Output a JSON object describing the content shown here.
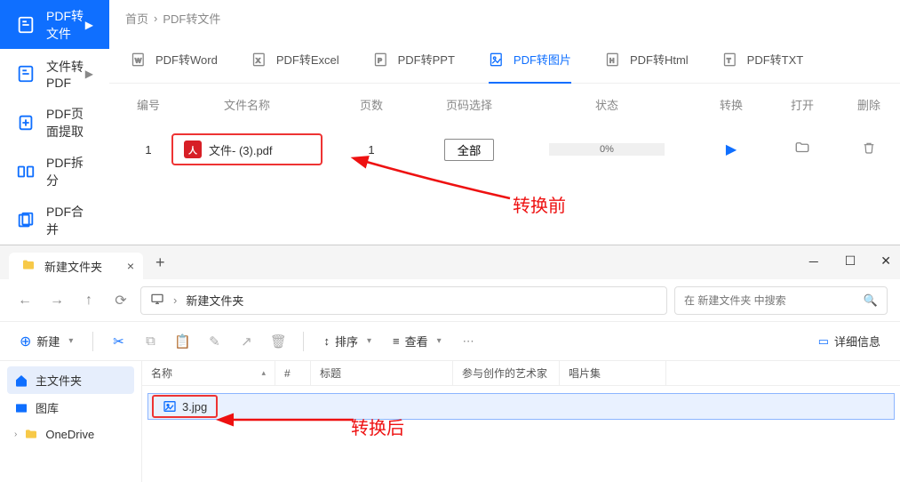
{
  "sidebar": {
    "items": [
      {
        "label": "PDF转文件",
        "arrow": "▶"
      },
      {
        "label": "文件转PDF",
        "arrow": "▶"
      },
      {
        "label": "PDF页面提取",
        "arrow": ""
      },
      {
        "label": "PDF拆分",
        "arrow": ""
      },
      {
        "label": "PDF合并",
        "arrow": ""
      }
    ]
  },
  "breadcrumb": {
    "home": "首页",
    "sep": "›",
    "current": "PDF转文件"
  },
  "tabs": [
    {
      "label": "PDF转Word"
    },
    {
      "label": "PDF转Excel"
    },
    {
      "label": "PDF转PPT"
    },
    {
      "label": "PDF转图片"
    },
    {
      "label": "PDF转Html"
    },
    {
      "label": "PDF转TXT"
    }
  ],
  "thead": {
    "num": "编号",
    "name": "文件名称",
    "pages": "页数",
    "select": "页码选择",
    "status": "状态",
    "conv": "转换",
    "open": "打开",
    "del": "删除"
  },
  "row": {
    "num": "1",
    "filename": "文件- (3).pdf",
    "pages": "1",
    "select_label": "全部",
    "progress": "0%"
  },
  "annotations": {
    "before": "转换前",
    "after": "转换后"
  },
  "explorer": {
    "tab_title": "新建文件夹",
    "path": "新建文件夹",
    "search_placeholder": "在 新建文件夹 中搜索",
    "new_label": "新建",
    "sort_label": "排序",
    "view_label": "查看",
    "detail_label": "详细信息",
    "side": [
      {
        "label": "主文件夹"
      },
      {
        "label": "图库"
      },
      {
        "label": "OneDrive"
      }
    ],
    "columns": {
      "name": "名称",
      "num": "#",
      "title": "标题",
      "artist": "参与创作的艺术家",
      "album": "唱片集"
    },
    "file": {
      "name": "3.jpg"
    }
  }
}
